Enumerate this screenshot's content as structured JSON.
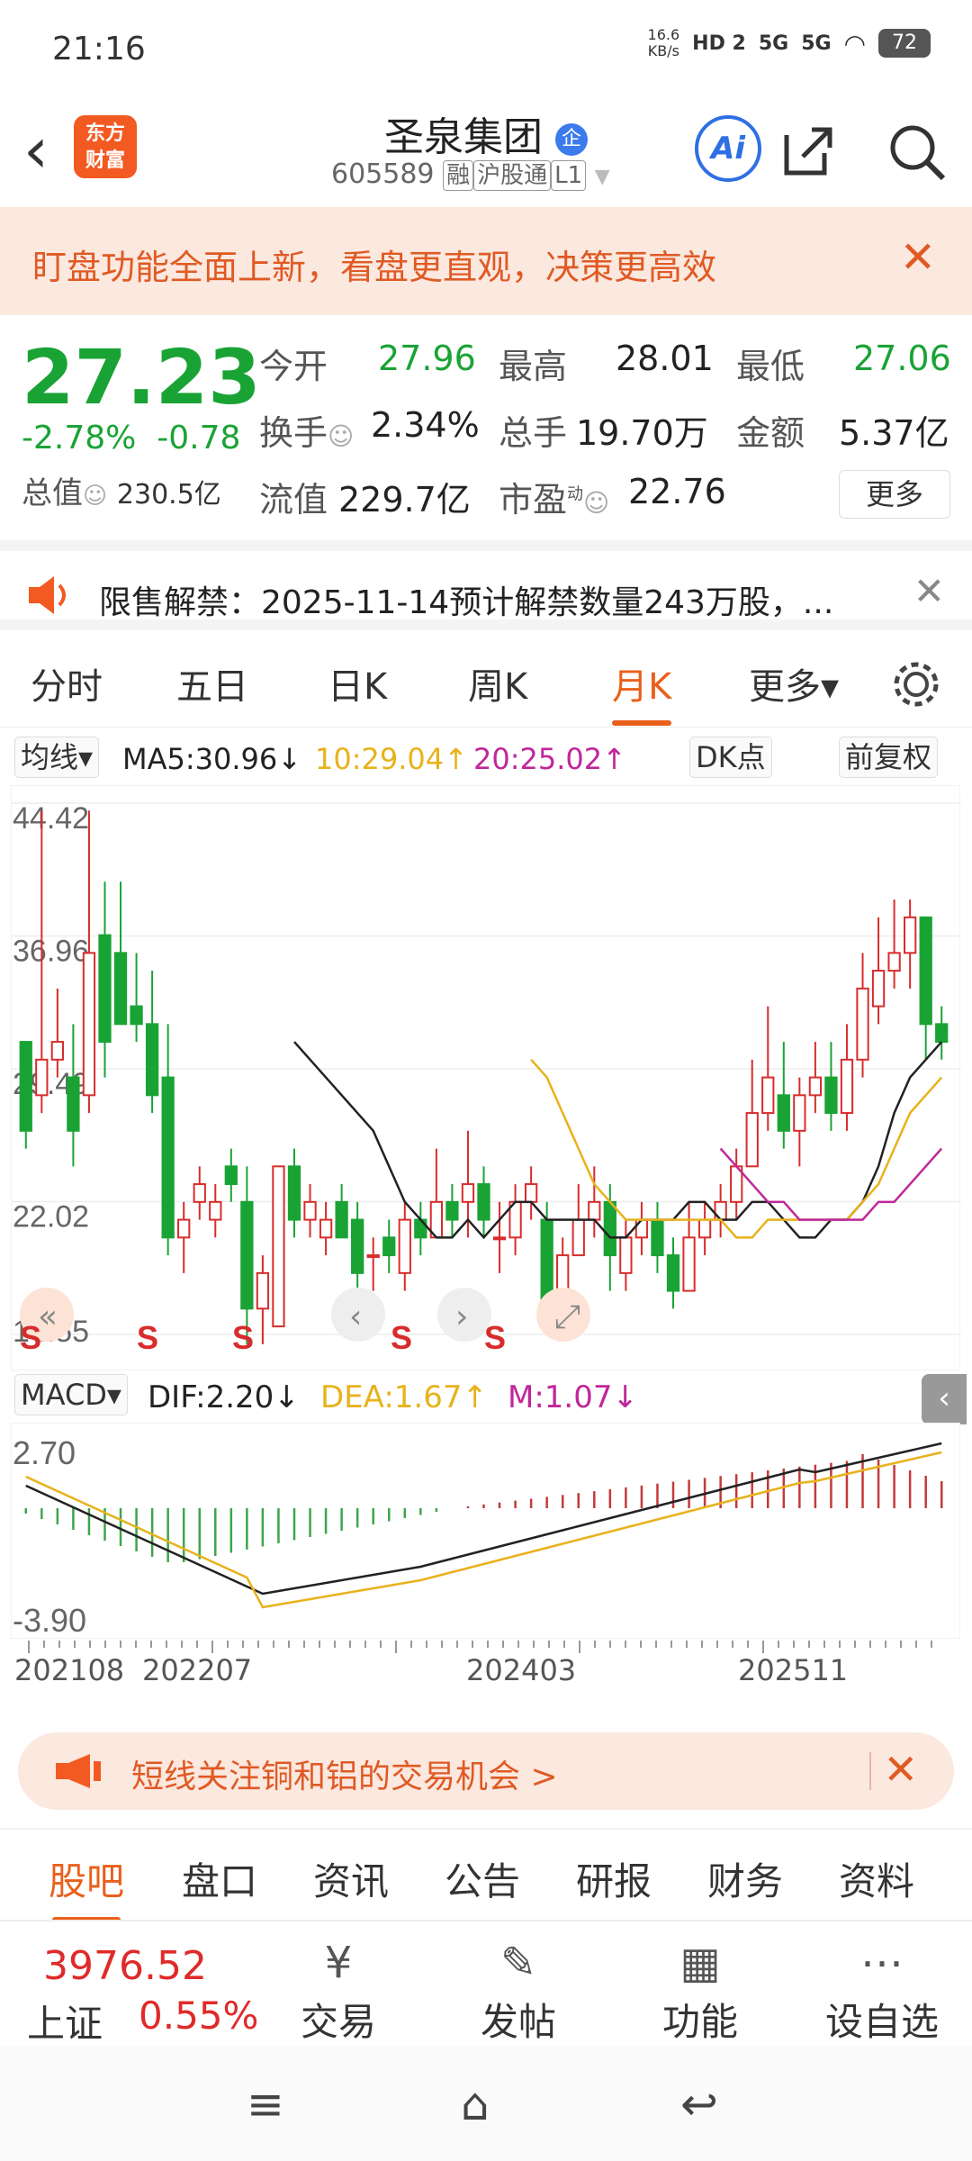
{
  "status": {
    "time": "21:16",
    "speed": "16.6",
    "speed_unit": "KB/s",
    "net1": "HD 2",
    "net2": "5G",
    "net3": "5G",
    "battery": "72"
  },
  "header": {
    "back": "‹",
    "logo": "东方\n财富",
    "title": "圣泉集团",
    "title_badge": "企",
    "code": "605589",
    "tags": [
      "融",
      "沪股通",
      "L1"
    ],
    "ai": "Ai"
  },
  "banner": {
    "text": "盯盘功能全面上新，看盘更直观，决策更高效",
    "close": "✕"
  },
  "quote": {
    "price": "27.23",
    "change_pct": "-2.78%",
    "change": "-0.78",
    "total_value_label": "总值",
    "total_value": "230.5亿",
    "open_label": "今开",
    "open": "27.96",
    "high_label": "最高",
    "high": "28.01",
    "low_label": "最低",
    "low": "27.06",
    "turnover_label": "换手",
    "turnover": "2.34%",
    "volume_label": "总手",
    "volume": "19.70万",
    "amount_label": "金额",
    "amount": "5.37亿",
    "float_label": "流值",
    "float_value": "229.7亿",
    "pe_label": "市盈",
    "pe_sup": "动",
    "pe": "22.76",
    "more": "更多"
  },
  "notice": {
    "text": "限售解禁：2025-11-14预计解禁数量243万股，...",
    "close": "✕"
  },
  "tabs": [
    "分时",
    "五日",
    "日K",
    "周K",
    "月K",
    "更多▾"
  ],
  "active_tab": 4,
  "ma": {
    "selector": "均线▾",
    "ma5": "MA5:30.96↓",
    "ma10": "10:29.04↑",
    "ma20": "20:25.02↑",
    "dk": "DK点",
    "adj": "前复权"
  },
  "chart_data": {
    "type": "candlestick",
    "y_ticks": [
      "44.42",
      "36.96",
      "29.49",
      "22.02",
      "14.55"
    ],
    "ylim": [
      14.55,
      44.42
    ],
    "x_labels": [
      "202108",
      "202207",
      "202403",
      "202511"
    ],
    "candles": [
      [
        31,
        31,
        25,
        26
      ],
      [
        28,
        44,
        27,
        30
      ],
      [
        30,
        34,
        29,
        31
      ],
      [
        29,
        32,
        24,
        26
      ],
      [
        28,
        44,
        27,
        36
      ],
      [
        37,
        40,
        29,
        31
      ],
      [
        36,
        40,
        33,
        32
      ],
      [
        33,
        36,
        31,
        32
      ],
      [
        32,
        35,
        27,
        28
      ],
      [
        29,
        32,
        19,
        20
      ],
      [
        20,
        22,
        18,
        21
      ],
      [
        22,
        24,
        21,
        23
      ],
      [
        21,
        23,
        20,
        22
      ],
      [
        24,
        25,
        22,
        23
      ],
      [
        22,
        24,
        14,
        16
      ],
      [
        16,
        19,
        14,
        18
      ],
      [
        15,
        24,
        15,
        24
      ],
      [
        24,
        25,
        20,
        21
      ],
      [
        21,
        23,
        20,
        22
      ],
      [
        20,
        22,
        19,
        21
      ],
      [
        22,
        23,
        20,
        20
      ],
      [
        21,
        22,
        17,
        18
      ],
      [
        19,
        20,
        17,
        19
      ],
      [
        20,
        21,
        18,
        19
      ],
      [
        18,
        22,
        17,
        21
      ],
      [
        21,
        22,
        19,
        20
      ],
      [
        20,
        25,
        20,
        22
      ],
      [
        22,
        23,
        20,
        21
      ],
      [
        22,
        26,
        20,
        23
      ],
      [
        23,
        24,
        20,
        21
      ],
      [
        20,
        22,
        18,
        20
      ],
      [
        20,
        23,
        19,
        22
      ],
      [
        22,
        24,
        21,
        23
      ],
      [
        21,
        22,
        15,
        16
      ],
      [
        15,
        20,
        15,
        19
      ],
      [
        19,
        23,
        19,
        21
      ],
      [
        21,
        24,
        20,
        22
      ],
      [
        22,
        23,
        17,
        19
      ],
      [
        18,
        21,
        17,
        20
      ],
      [
        20,
        22,
        19,
        21
      ],
      [
        21,
        22,
        18,
        19
      ],
      [
        19,
        20,
        16,
        17
      ],
      [
        17,
        22,
        17,
        20
      ],
      [
        20,
        22,
        19,
        21
      ],
      [
        21,
        23,
        20,
        22
      ],
      [
        22,
        25,
        21,
        24
      ],
      [
        24,
        30,
        24,
        27
      ],
      [
        27,
        33,
        26,
        29
      ],
      [
        28,
        31,
        25,
        26
      ],
      [
        26,
        29,
        24,
        28
      ],
      [
        28,
        31,
        27,
        29
      ],
      [
        29,
        31,
        26,
        27
      ],
      [
        27,
        32,
        26,
        30
      ],
      [
        30,
        36,
        29,
        34
      ],
      [
        33,
        38,
        32,
        35
      ],
      [
        35,
        39,
        34,
        36
      ],
      [
        36,
        39,
        34,
        38
      ],
      [
        38,
        37,
        30,
        32
      ],
      [
        32,
        33,
        30,
        31
      ]
    ],
    "ma5": [
      31,
      30,
      29,
      28,
      27,
      26,
      24,
      22,
      21,
      20,
      20,
      21,
      20,
      21,
      22,
      22,
      21,
      21,
      21,
      21,
      20,
      20,
      21,
      21,
      21,
      22,
      22,
      21,
      21,
      22,
      22,
      21,
      20,
      20,
      21,
      21,
      22,
      24,
      27,
      29,
      30,
      31
    ],
    "ma10": [
      30,
      29,
      27,
      25,
      23,
      22,
      21,
      21,
      21,
      21,
      21,
      21,
      21,
      20,
      20,
      21,
      21,
      21,
      21,
      21,
      21,
      22,
      23,
      25,
      27,
      28,
      29
    ],
    "ma20": [
      25,
      24,
      23,
      22,
      22,
      21,
      21,
      21,
      21,
      21,
      22,
      22,
      23,
      24,
      25
    ]
  },
  "macd": {
    "selector": "MACD▾",
    "dif": "DIF:2.20↓",
    "dea": "DEA:1.67↑",
    "m": "M:1.07↓",
    "y_top": "2.70",
    "y_bottom": "-3.90"
  },
  "promo": {
    "text": "短线关注铜和铝的交易机会 >",
    "close": "✕"
  },
  "subtabs": [
    "股吧",
    "盘口",
    "资讯",
    "公告",
    "研报",
    "财务",
    "资料"
  ],
  "bottom": {
    "index_value": "3976.52",
    "index_name": "上证",
    "index_change": "0.55%",
    "buttons": [
      "交易",
      "发帖",
      "功能",
      "设自选"
    ]
  },
  "nav": [
    "≡",
    "⌂",
    "↩"
  ]
}
